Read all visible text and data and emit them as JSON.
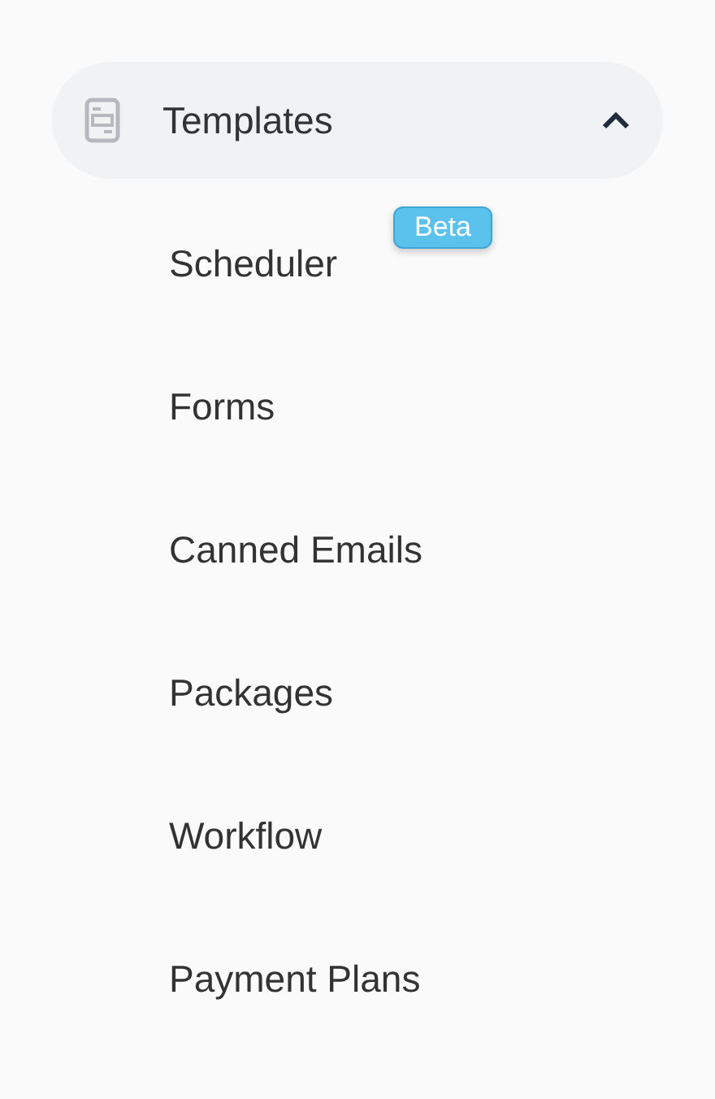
{
  "section": {
    "label": "Templates",
    "expanded": true
  },
  "items": [
    {
      "label": "Scheduler",
      "badge": "Beta"
    },
    {
      "label": "Forms"
    },
    {
      "label": "Canned Emails"
    },
    {
      "label": "Packages"
    },
    {
      "label": "Workflow"
    },
    {
      "label": "Payment Plans"
    }
  ]
}
